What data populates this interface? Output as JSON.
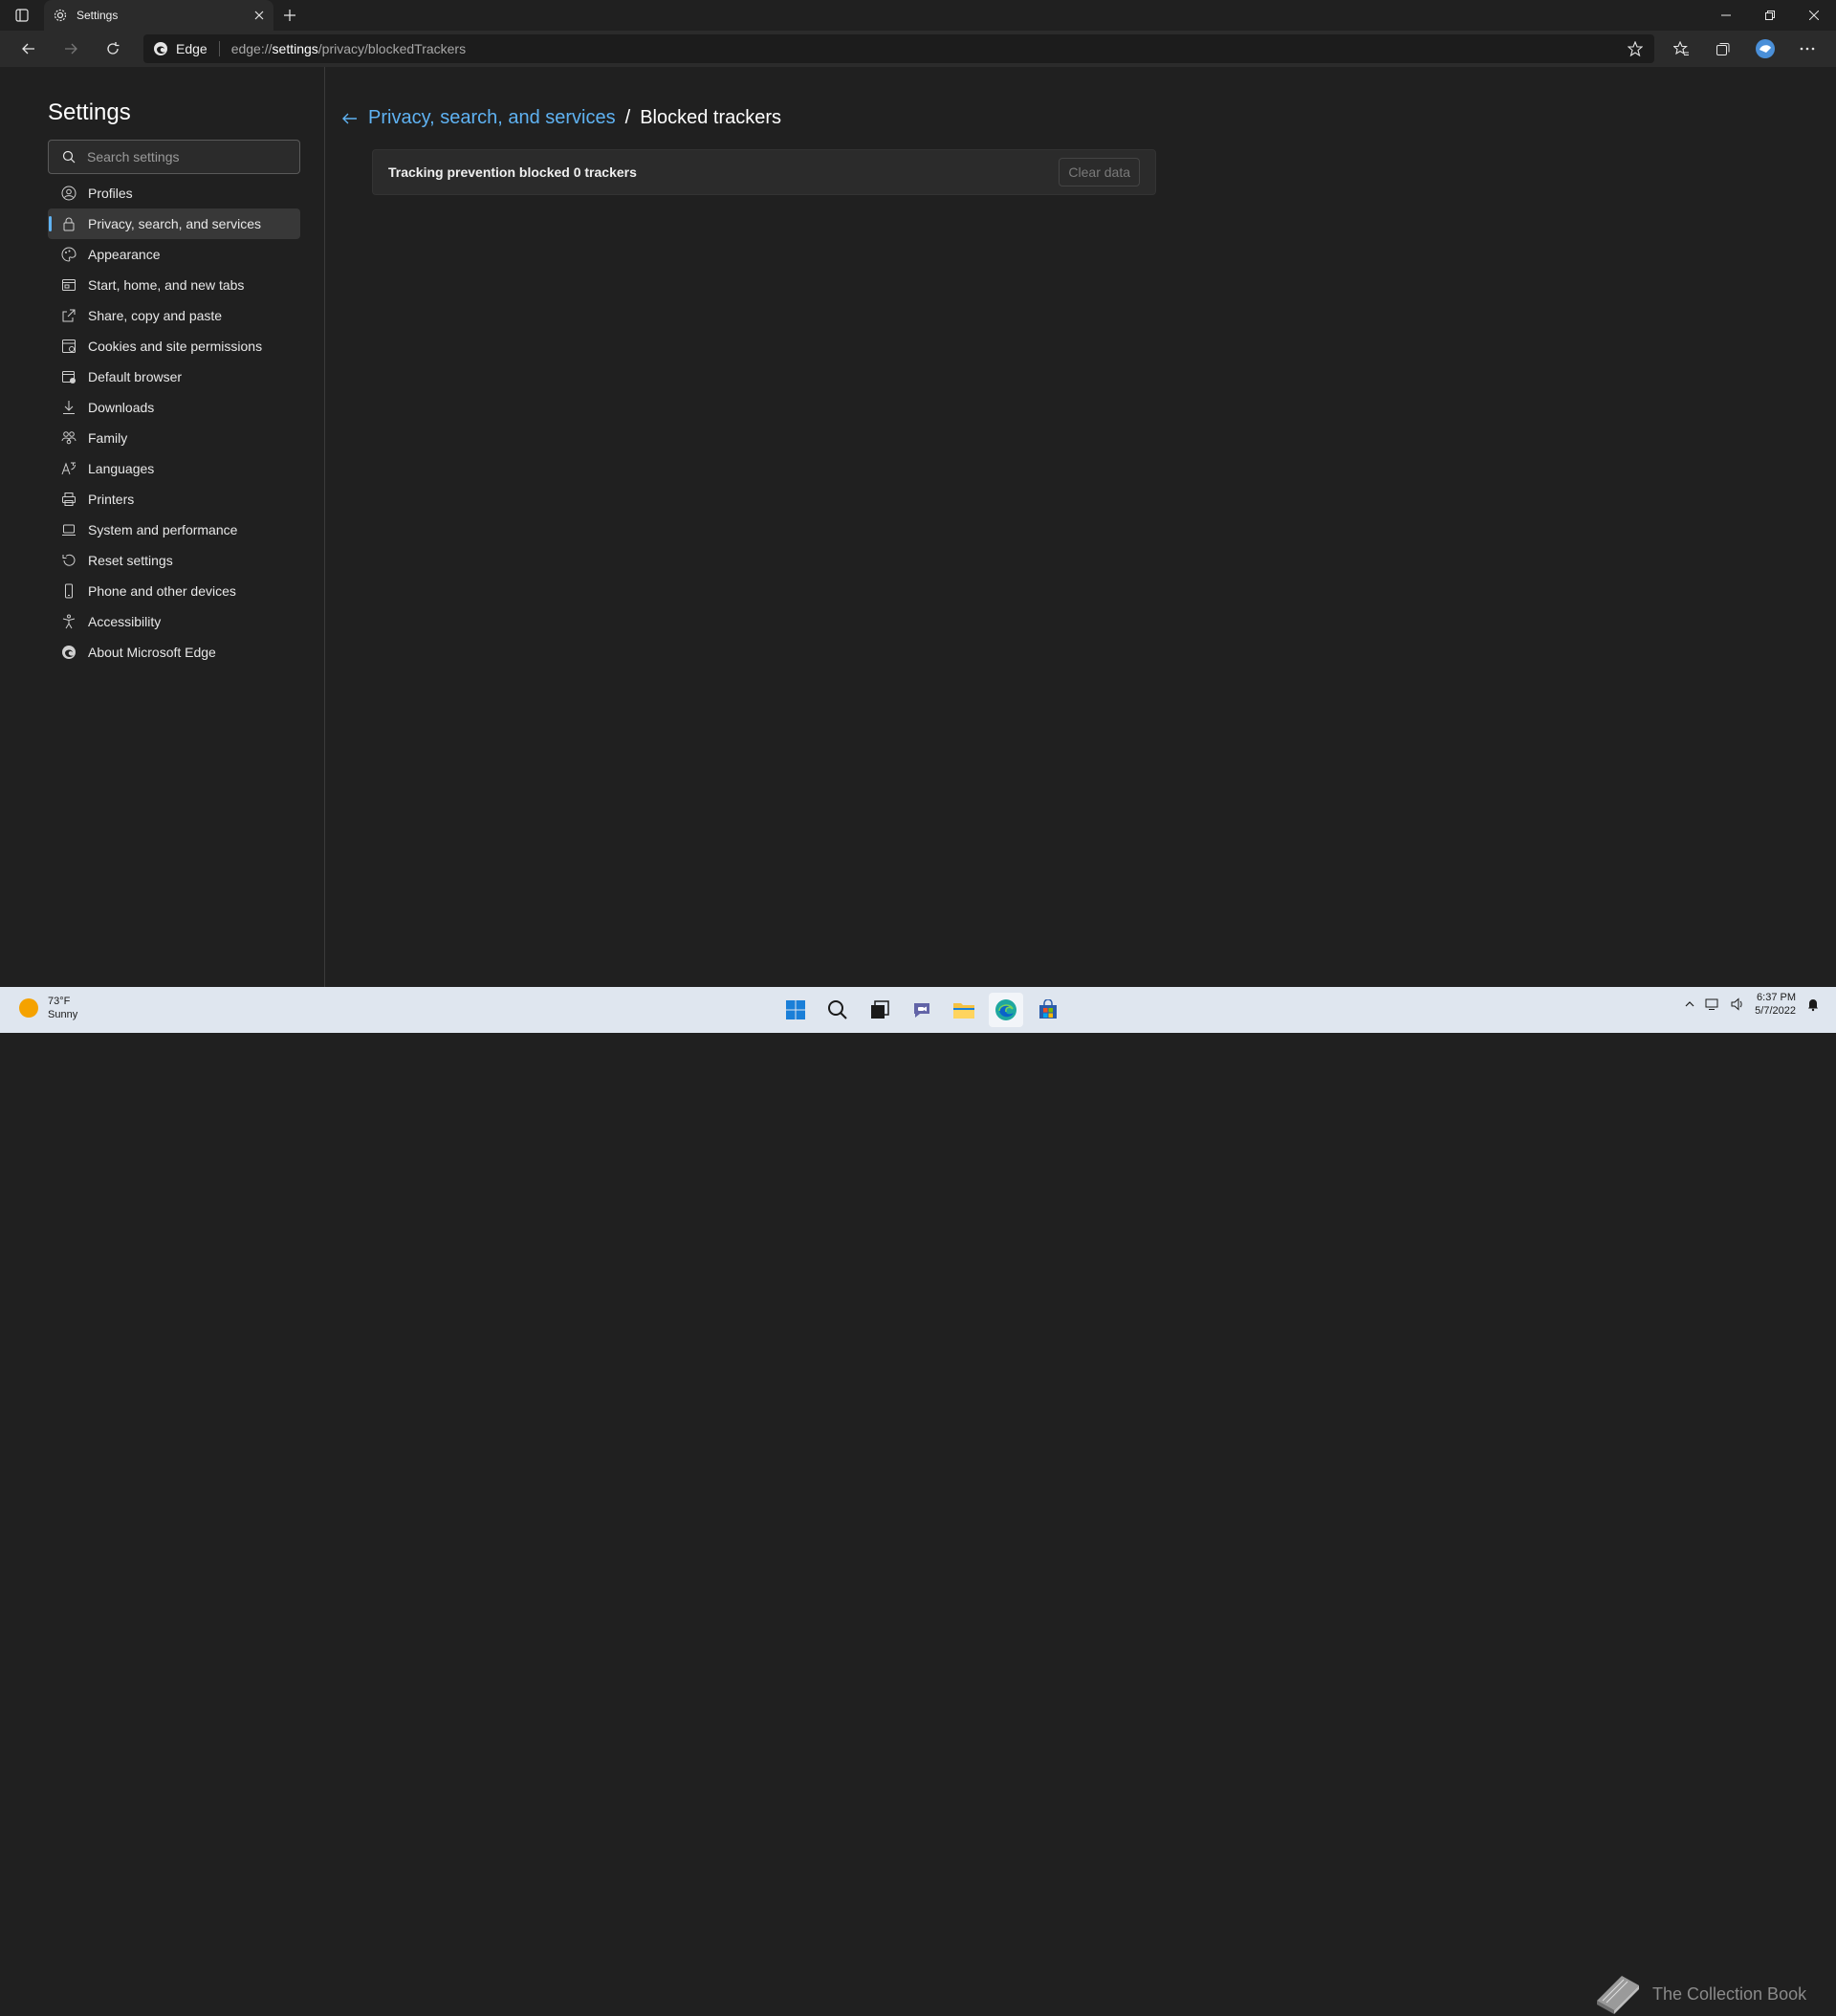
{
  "browser": {
    "tab_title": "Settings",
    "site_label": "Edge",
    "url_prefix": "edge://",
    "url_host": "settings",
    "url_path": "/privacy/blockedTrackers"
  },
  "sidebar": {
    "title": "Settings",
    "search_placeholder": "Search settings",
    "items": [
      {
        "label": "Profiles",
        "icon": "profile-icon"
      },
      {
        "label": "Privacy, search, and services",
        "icon": "lock-icon",
        "active": true
      },
      {
        "label": "Appearance",
        "icon": "palette-icon"
      },
      {
        "label": "Start, home, and new tabs",
        "icon": "home-tabs-icon"
      },
      {
        "label": "Share, copy and paste",
        "icon": "share-icon"
      },
      {
        "label": "Cookies and site permissions",
        "icon": "cookies-icon"
      },
      {
        "label": "Default browser",
        "icon": "browser-icon"
      },
      {
        "label": "Downloads",
        "icon": "download-icon"
      },
      {
        "label": "Family",
        "icon": "family-icon"
      },
      {
        "label": "Languages",
        "icon": "languages-icon"
      },
      {
        "label": "Printers",
        "icon": "printer-icon"
      },
      {
        "label": "System and performance",
        "icon": "laptop-icon"
      },
      {
        "label": "Reset settings",
        "icon": "reset-icon"
      },
      {
        "label": "Phone and other devices",
        "icon": "phone-icon"
      },
      {
        "label": "Accessibility",
        "icon": "accessibility-icon"
      },
      {
        "label": "About Microsoft Edge",
        "icon": "edge-logo-icon"
      }
    ]
  },
  "main": {
    "breadcrumb_parent": "Privacy, search, and services",
    "breadcrumb_sep": "/",
    "breadcrumb_current": "Blocked trackers",
    "tracking_text": "Tracking prevention blocked 0 trackers",
    "clear_button": "Clear data"
  },
  "taskbar": {
    "temperature": "73°F",
    "condition": "Sunny",
    "time": "6:37 PM",
    "date": "5/7/2022"
  },
  "watermark": "The Collection Book",
  "colors": {
    "accent": "#5fb2f2",
    "background": "#202020",
    "card": "#2b2b2b",
    "taskbar": "#dfe6ef"
  }
}
